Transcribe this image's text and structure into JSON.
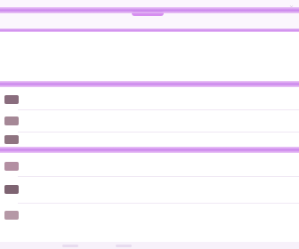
{
  "window": {
    "title": "",
    "subtitle": ""
  },
  "sections": [
    {
      "label": "",
      "items": [
        {
          "label": "",
          "color": "#8a6d7e"
        },
        {
          "label": "",
          "color": "#a58896"
        },
        {
          "label": "",
          "color": "#8f7481"
        }
      ]
    },
    {
      "label": "",
      "items": [
        {
          "label": "",
          "color": "#b38fa2"
        },
        {
          "label": "",
          "color": "#7e6472"
        },
        {
          "label": "",
          "color": "#b598a6"
        }
      ]
    }
  ],
  "colors": {
    "accent": "#c477ea",
    "header_bg": "#fbf6fd",
    "divider": "#f0e8f4"
  },
  "icons": [
    "close-icon"
  ]
}
